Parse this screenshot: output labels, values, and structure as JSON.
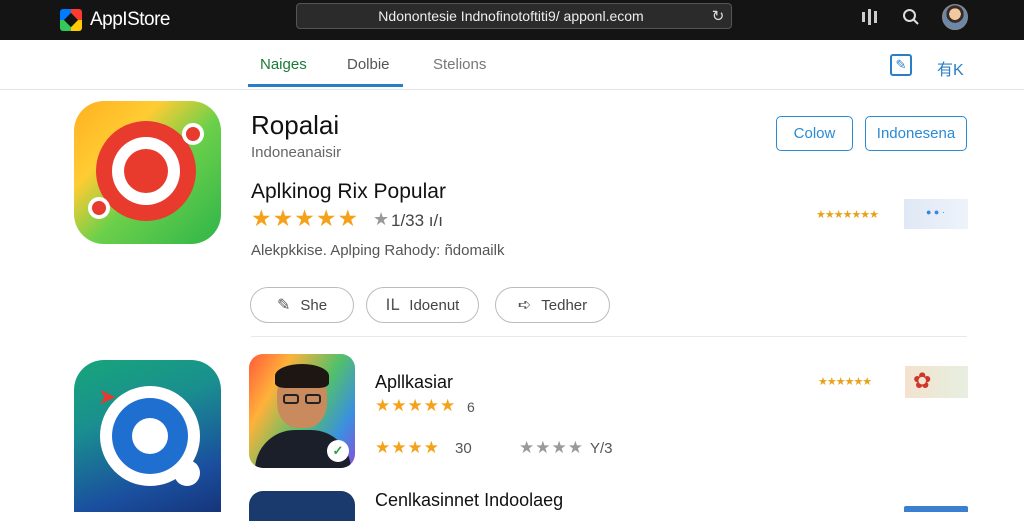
{
  "topbar": {
    "brand": "AppIStore",
    "url": "Ndonontesie Indnofinotoftiti9/ apponl.ecom",
    "icons": [
      "stats-icon",
      "search-icon",
      "avatar"
    ]
  },
  "tabs": {
    "items": [
      {
        "label": "Naiges",
        "active": true
      },
      {
        "label": "Dolbie",
        "active": false
      },
      {
        "label": "Stelions",
        "active": false
      }
    ],
    "right_label": "有K"
  },
  "app1": {
    "title": "Ropalai",
    "subtitle": "Indoneanaisir",
    "section": "Aplkinog Rix Popular",
    "stars": "★★★★★",
    "star_half": "★",
    "rating": "1/33 ı/ı",
    "meta": "Alekpkkise. Aplping  Rahody: ñdomailk",
    "buttons": {
      "colow": "Colow",
      "indonesia": "Indonesena"
    },
    "pills": [
      {
        "label": "She",
        "icon": "pencil-icon"
      },
      {
        "label": "Idoenut",
        "icon": "chart-icon"
      },
      {
        "label": "Tedher",
        "icon": "share-icon"
      }
    ],
    "strip_stars": "★★★★★★★"
  },
  "app2": {
    "title": "Apllkasiar",
    "stars": "★★★★★",
    "count": "6",
    "stars_b": "★★★★",
    "count_b": "30",
    "stars_gray": "★★★★",
    "count_c": "Y/3",
    "strip_stars": "★★★★★★"
  },
  "app3": {
    "title": "Cenlkasinnet Indoolaeg"
  },
  "colors": {
    "accent": "#2a8ad4",
    "star": "#f4a21a",
    "active_tab": "#1b7a38",
    "topbar": "#141414"
  }
}
